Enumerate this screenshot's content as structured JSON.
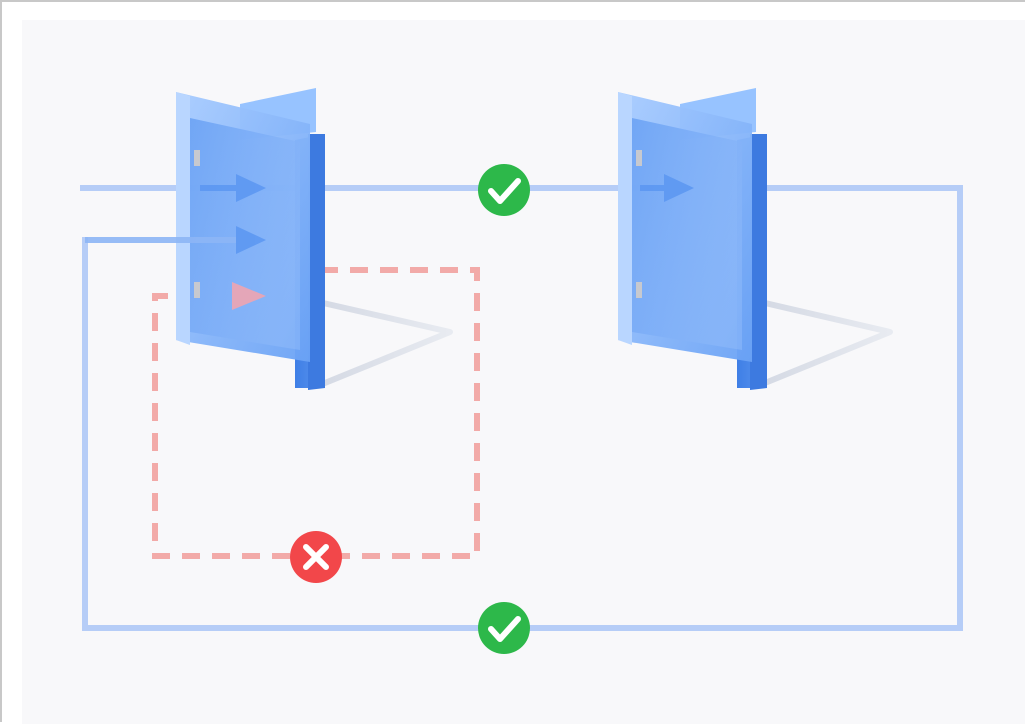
{
  "diagram": {
    "colors": {
      "background": "#f8f8fa",
      "frame_border": "#c8c8c8",
      "allowed_path": "#b6cdf7",
      "blocked_path": "#f2aaa8",
      "door_light": "#9cc4ff",
      "door_mid": "#6ea6f7",
      "door_dark": "#4a88ea",
      "door_shadow": "#dde1ea",
      "check_badge": "#2db84a",
      "cross_badge": "#f2474a"
    },
    "doors": [
      {
        "name": "first-door",
        "icon": "open-door-icon"
      },
      {
        "name": "second-door",
        "icon": "open-door-icon"
      }
    ],
    "paths": [
      {
        "name": "top-path",
        "status": "allowed",
        "badge": "check-icon"
      },
      {
        "name": "loop-back-path",
        "status": "allowed",
        "badge": "check-icon"
      },
      {
        "name": "blocked-loop-path",
        "status": "blocked",
        "badge": "cross-icon"
      }
    ]
  }
}
